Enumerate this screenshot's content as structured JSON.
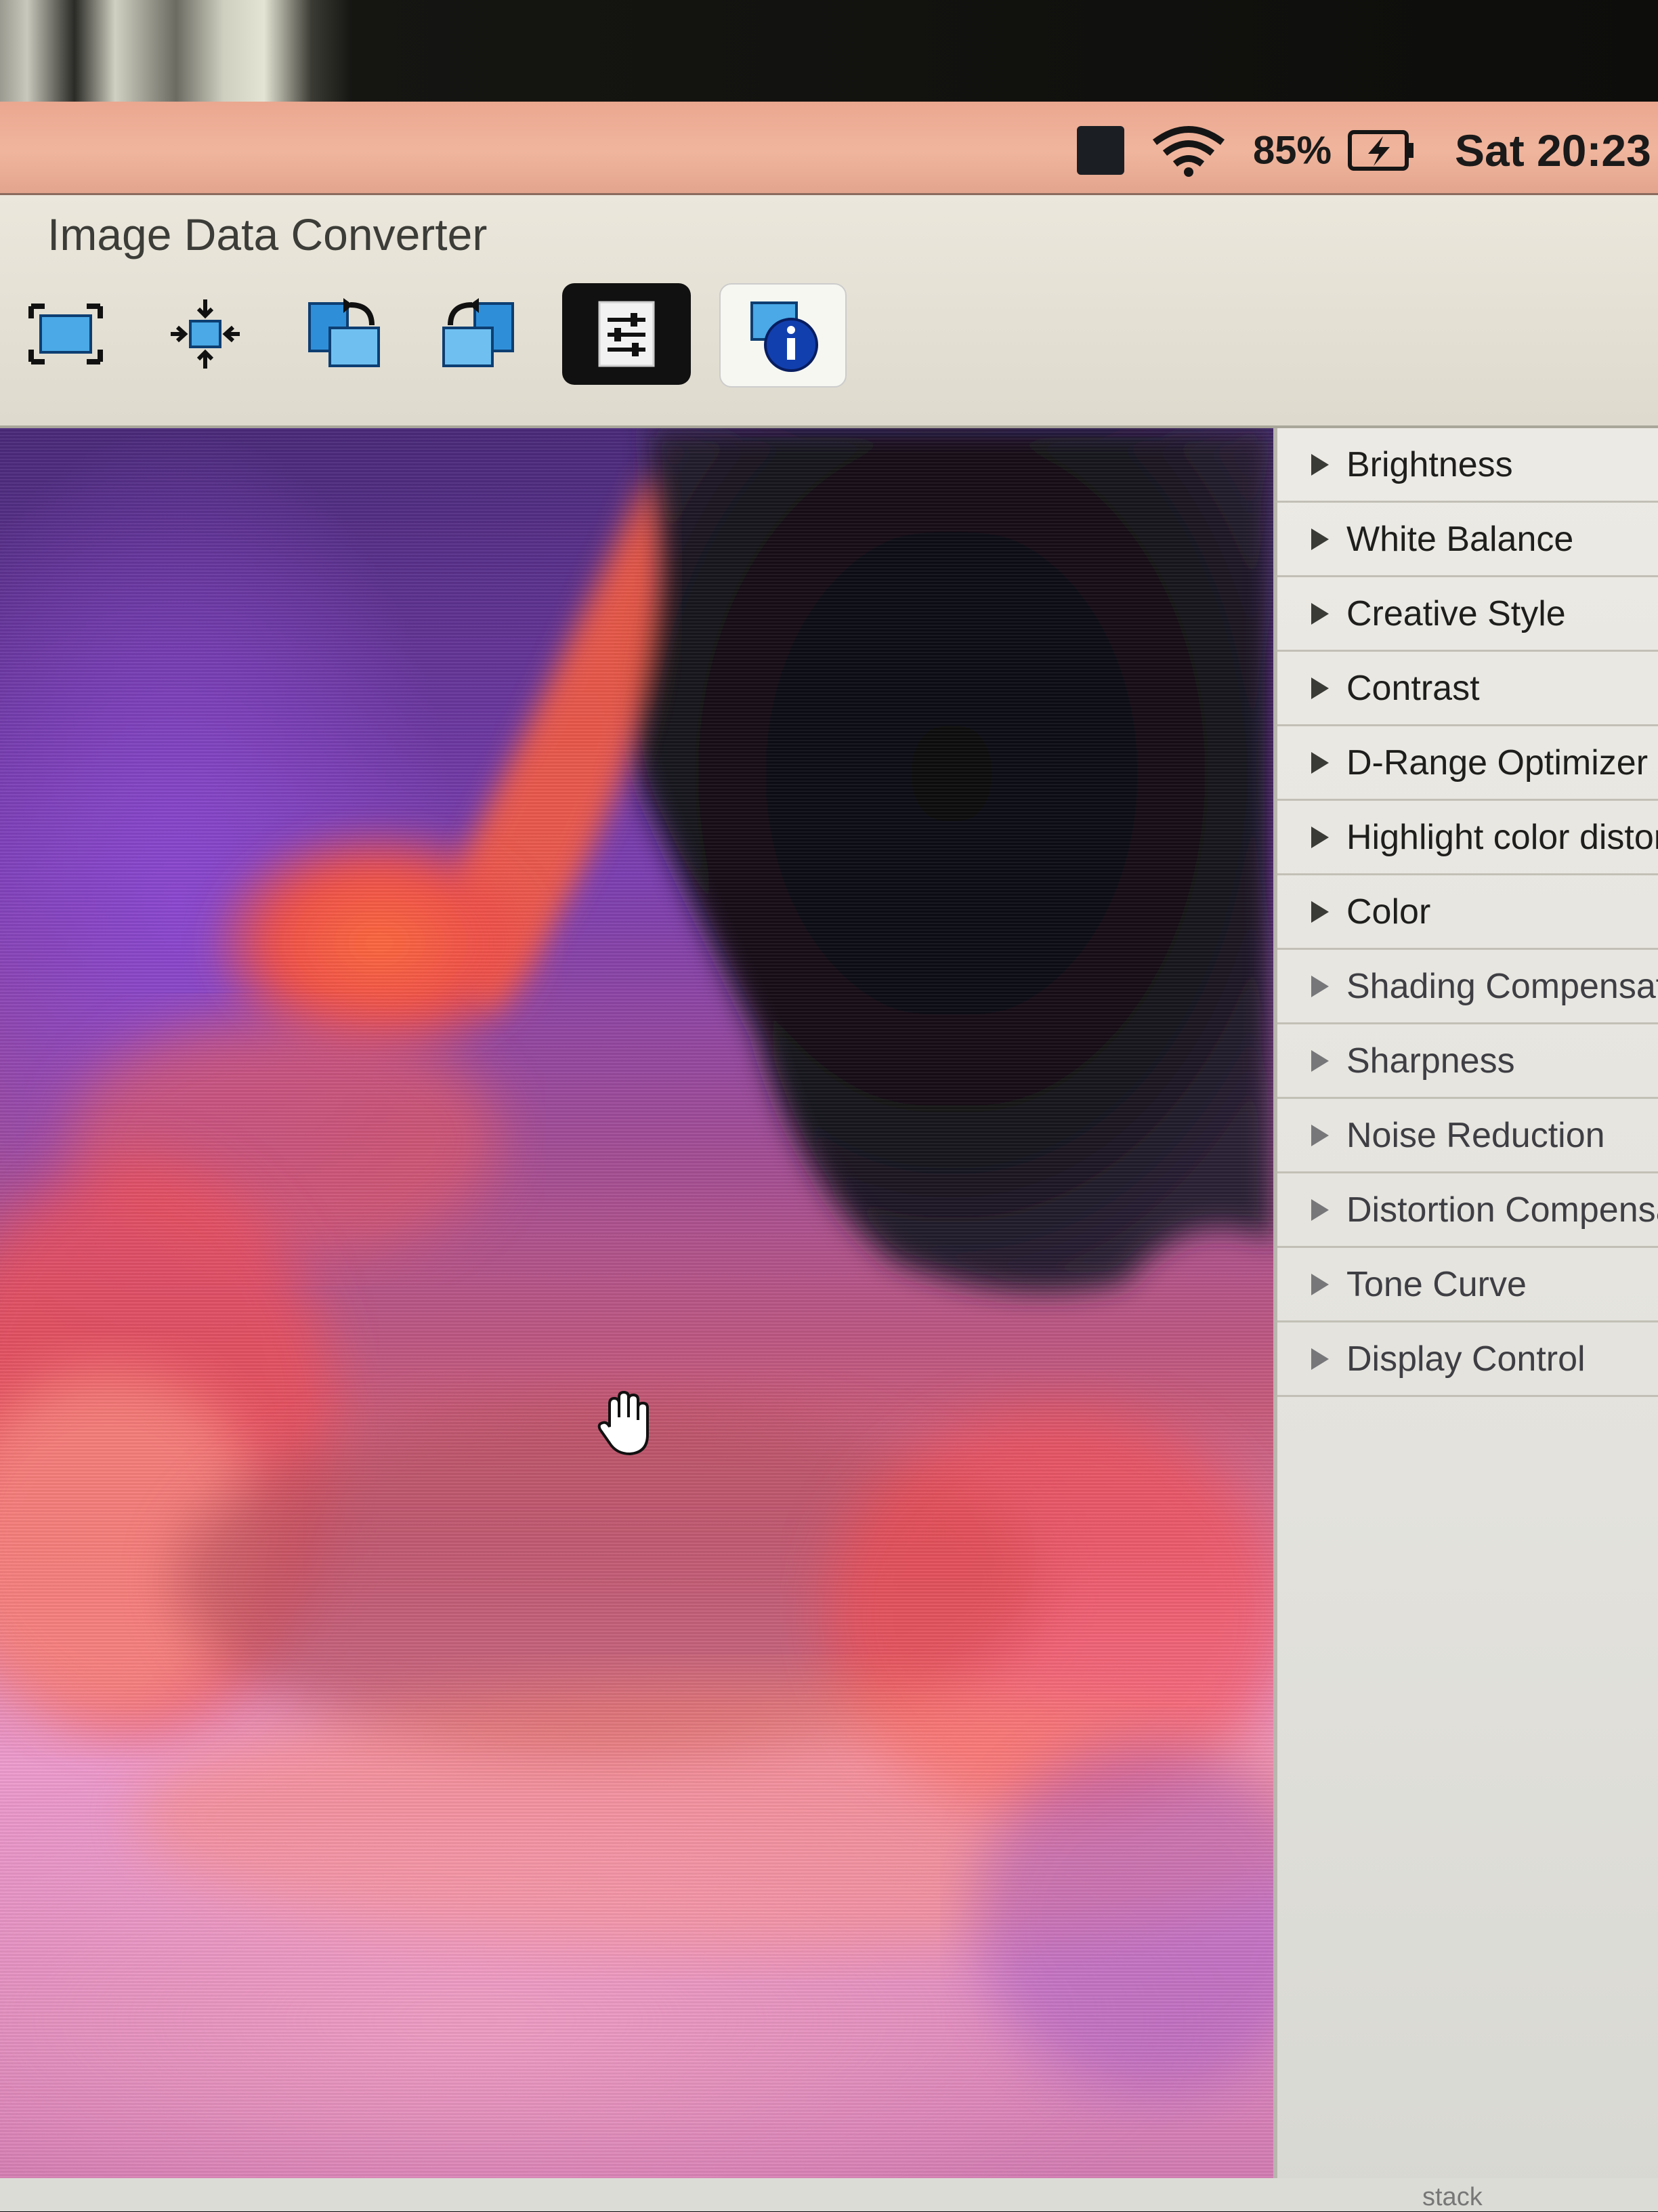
{
  "menubar": {
    "battery_percent": "85%",
    "clock": "Sat 20:23",
    "icons": [
      "app-status-icon",
      "wifi-icon",
      "battery-charging-icon"
    ]
  },
  "window": {
    "title": "Image Data Converter"
  },
  "toolbar": {
    "buttons": [
      {
        "name": "fit-to-screen-icon"
      },
      {
        "name": "actual-size-icon"
      },
      {
        "name": "rotate-left-icon"
      },
      {
        "name": "rotate-right-icon"
      },
      {
        "name": "adjust-palette-icon",
        "selected": true
      },
      {
        "name": "info-icon",
        "selected": false
      }
    ]
  },
  "panel": {
    "items": [
      {
        "label": "Brightness"
      },
      {
        "label": "White Balance"
      },
      {
        "label": "Creative Style"
      },
      {
        "label": "Contrast"
      },
      {
        "label": "D-Range Optimizer"
      },
      {
        "label": "Highlight color distor"
      },
      {
        "label": "Color"
      },
      {
        "label": "Shading Compensati"
      },
      {
        "label": "Sharpness"
      },
      {
        "label": "Noise Reduction"
      },
      {
        "label": "Distortion Compensat"
      },
      {
        "label": "Tone Curve"
      },
      {
        "label": "Display Control"
      }
    ]
  },
  "footer": {
    "fragment": "stack"
  },
  "colors": {
    "menubar": "#eba790",
    "titlebar": "#e6e2d6",
    "panel": "#eceae4",
    "sky_dark": "#0e0c14",
    "cloud_red": "#ff5a3a",
    "sky_pink": "#f09ad6",
    "sky_purple": "#7d3fb6"
  }
}
